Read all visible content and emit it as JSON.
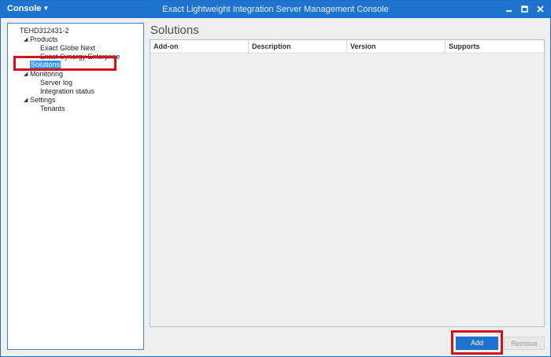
{
  "titlebar": {
    "menu_label": "Console",
    "title": "Exact Lightweight Integration Server Management Console"
  },
  "tree": {
    "root": "TEHD312431-2",
    "products": "Products",
    "product_items": [
      "Exact Globe Next",
      "Exact Synergy Enterprise"
    ],
    "solutions": "Solutions",
    "monitoring": "Monitoring",
    "monitoring_items": [
      "Server log",
      "Integration status"
    ],
    "settings": "Settings",
    "settings_items": [
      "Tenants"
    ]
  },
  "content": {
    "title": "Solutions",
    "columns": [
      "Add-on",
      "Description",
      "Version",
      "Supports"
    ]
  },
  "buttons": {
    "add": "Add",
    "remove": "Remove"
  },
  "colors": {
    "titlebar": "#1e73cf",
    "highlight": "#d4121e",
    "selection": "#3399ff"
  }
}
